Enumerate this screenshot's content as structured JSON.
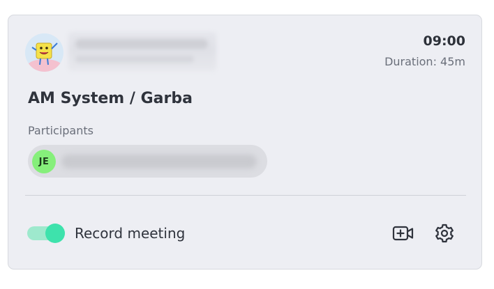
{
  "meeting": {
    "time": "09:00",
    "duration": "Duration: 45m",
    "title": "AM System / Garba",
    "participants_label": "Participants",
    "participants": [
      {
        "initials": "JE"
      }
    ]
  },
  "footer": {
    "record_label": "Record meeting",
    "record_enabled": true
  },
  "colors": {
    "card_background": "#edeef3",
    "toggle_on": "#3ee2ac",
    "participant_avatar": "#86ef7b"
  },
  "icons": {
    "video": "video-plus-icon",
    "settings": "gear-icon"
  }
}
